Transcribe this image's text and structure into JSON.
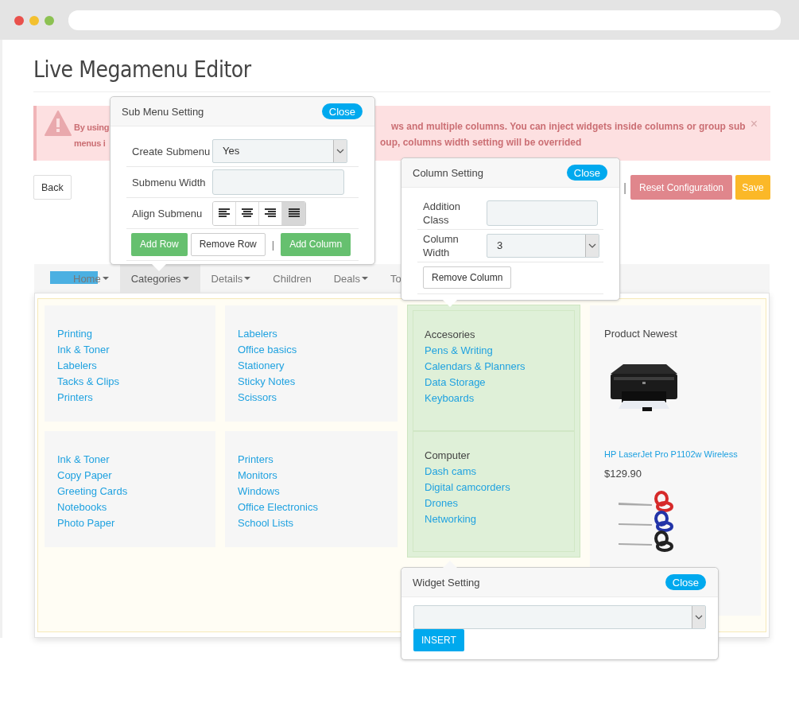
{
  "title": "Live Megamenu Editor",
  "alert": {
    "left_lines": [
      "By using",
      "menus i"
    ],
    "right_lines": [
      "ws and multiple columns. You can inject widgets inside columns or group sub",
      "oup, columns width setting will be overrided"
    ],
    "close": "×"
  },
  "toolbar": {
    "back": "Back",
    "separator": "|",
    "buttons": [
      {
        "label": "Reset Configuration",
        "kind": "danger"
      },
      {
        "label": "Save",
        "kind": "warning"
      }
    ]
  },
  "menu": [
    {
      "label": "Home",
      "caret": true,
      "selected": false,
      "highlighted": true
    },
    {
      "label": "Categories",
      "caret": true,
      "selected": true,
      "highlighted": false
    },
    {
      "label": "Details",
      "caret": true,
      "selected": false,
      "highlighted": false
    },
    {
      "label": "Children",
      "caret": false,
      "selected": false,
      "highlighted": false
    },
    {
      "label": "Deals",
      "caret": true,
      "selected": false,
      "highlighted": false
    },
    {
      "label": "To",
      "caret": false,
      "selected": false,
      "highlighted": false
    }
  ],
  "columns": [
    {
      "kind": "links",
      "selected": false,
      "groups": [
        {
          "items": [
            "Printing",
            "Ink & Toner",
            "Labelers",
            "Tacks & Clips",
            "Printers"
          ]
        },
        {
          "items": [
            "Ink & Toner",
            "Copy Paper",
            "Greeting Cards",
            "Notebooks",
            "Photo Paper"
          ]
        }
      ]
    },
    {
      "kind": "links",
      "selected": false,
      "groups": [
        {
          "items": [
            "Labelers",
            "Office basics",
            "Stationery",
            "Sticky Notes",
            "Scissors"
          ]
        },
        {
          "items": [
            "Printers",
            "Monitors",
            "Windows",
            "Office Electronics",
            "School Lists"
          ]
        }
      ]
    },
    {
      "kind": "links",
      "selected": true,
      "groups": [
        {
          "title": "Accesories",
          "items": [
            "Pens & Writing",
            "Calendars & Planners",
            "Data Storage",
            "Keyboards"
          ]
        },
        {
          "title": "Computer",
          "items": [
            "Dash cams",
            "Digital camcorders",
            "Drones",
            "Networking"
          ]
        }
      ]
    },
    {
      "kind": "products",
      "selected": false,
      "title": "Product Newest",
      "products": [
        {
          "kind": "printer",
          "name": "HP LaserJet Pro P1102w Wireless",
          "price": "$129.90"
        },
        {
          "kind": "scissors"
        }
      ]
    }
  ],
  "submenu_setting": {
    "title": "Sub Menu Setting",
    "close": "Close",
    "fields": [
      {
        "label": "Create Submenu",
        "kind": "select",
        "value": "Yes"
      },
      {
        "label": "Submenu Width",
        "kind": "input"
      },
      {
        "label": "Align Submenu",
        "kind": "align",
        "options": [
          {
            "kind": "left",
            "selected": false
          },
          {
            "kind": "center",
            "selected": false
          },
          {
            "kind": "right",
            "selected": false
          },
          {
            "kind": "justify",
            "selected": true
          }
        ]
      }
    ],
    "buttons": [
      {
        "label": "Add Row",
        "kind": "primary"
      },
      {
        "label": "Remove Row",
        "kind": "default"
      },
      {
        "label": "|",
        "kind": "separator"
      },
      {
        "label": "Add Column",
        "kind": "primary"
      }
    ]
  },
  "column_setting": {
    "title": "Column Setting",
    "close": "Close",
    "fields": [
      {
        "label": "Addition Class",
        "kind": "input"
      },
      {
        "label": "Column Width",
        "kind": "select",
        "value": "3"
      }
    ],
    "buttons": [
      {
        "label": "Remove Column",
        "kind": "default"
      }
    ]
  },
  "widget_setting": {
    "title": "Widget Setting",
    "close": "Close",
    "button": "INSERT"
  }
}
